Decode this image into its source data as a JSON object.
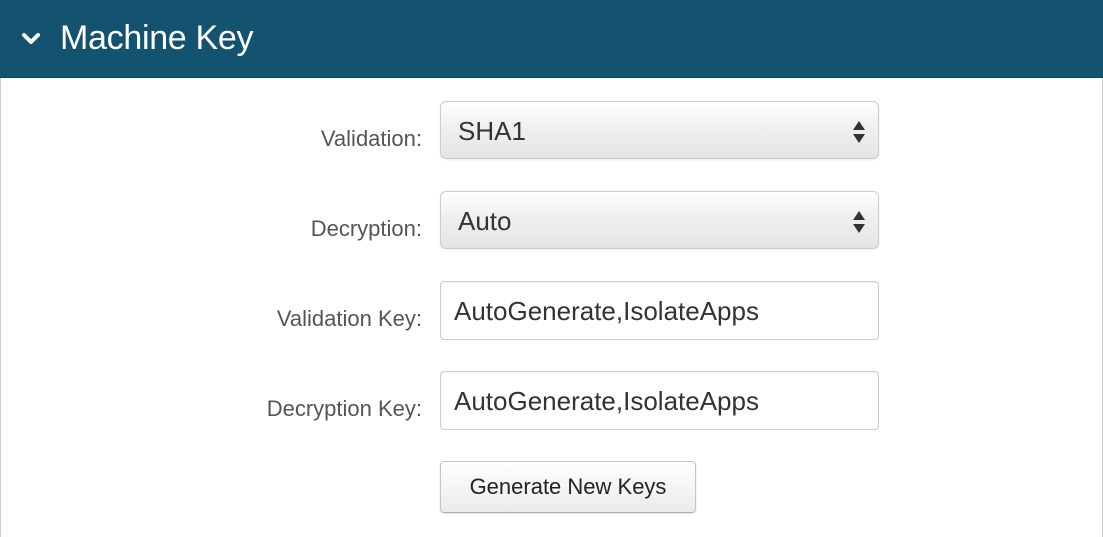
{
  "panel": {
    "title": "Machine Key",
    "icons": {
      "toggle": "chevron-down-icon",
      "select_arrows": "up-down-arrows-icon"
    },
    "colors": {
      "header_background": "#14536f",
      "header_text": "#ffffff"
    }
  },
  "form": {
    "validation": {
      "label": "Validation:",
      "selected": "SHA1"
    },
    "decryption": {
      "label": "Decryption:",
      "selected": "Auto"
    },
    "validation_key": {
      "label": "Validation Key:",
      "value": "AutoGenerate,IsolateApps"
    },
    "decryption_key": {
      "label": "Decryption Key:",
      "value": "AutoGenerate,IsolateApps"
    },
    "generate_button": "Generate New Keys"
  }
}
